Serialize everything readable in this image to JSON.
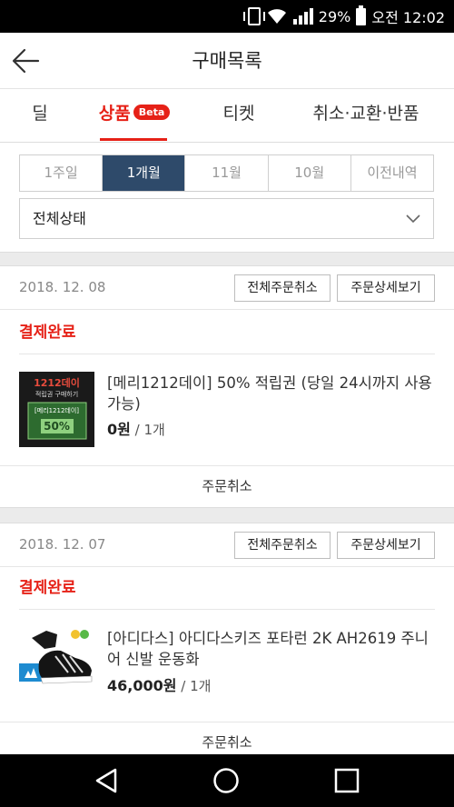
{
  "status_bar": {
    "battery": "29%",
    "time": "오전 12:02"
  },
  "header": {
    "title": "구매목록"
  },
  "tabs": [
    {
      "label": "딜"
    },
    {
      "label": "상품",
      "badge": "Beta"
    },
    {
      "label": "티켓"
    },
    {
      "label": "취소·교환·반품"
    }
  ],
  "periods": [
    "1주일",
    "1개월",
    "11월",
    "10월",
    "이전내역"
  ],
  "filter": {
    "selected": "전체상태"
  },
  "orders": [
    {
      "date": "2018. 12. 08",
      "cancel_all_label": "전체주문취소",
      "detail_label": "주문상세보기",
      "status": "결제완료",
      "thumb": {
        "line1": "1212데이",
        "line2": "적립권 구매하기",
        "line3": "[메리1212데이]",
        "line4": "50%"
      },
      "product_name": "[메리1212데이] 50% 적립권 (당일 24시까지 사용가능)",
      "price": "0원",
      "qty": "/ 1개",
      "cancel_label": "주문취소"
    },
    {
      "date": "2018. 12. 07",
      "cancel_all_label": "전체주문취소",
      "detail_label": "주문상세보기",
      "status": "결제완료",
      "product_name": "[아디다스] 아디다스키즈 포타런 2K AH2619 주니어 신발 운동화",
      "price": "46,000원",
      "qty": "/ 1개",
      "cancel_label": "주문취소"
    }
  ],
  "colors": {
    "accent": "#e62117",
    "period_active": "#2e4a6a"
  }
}
